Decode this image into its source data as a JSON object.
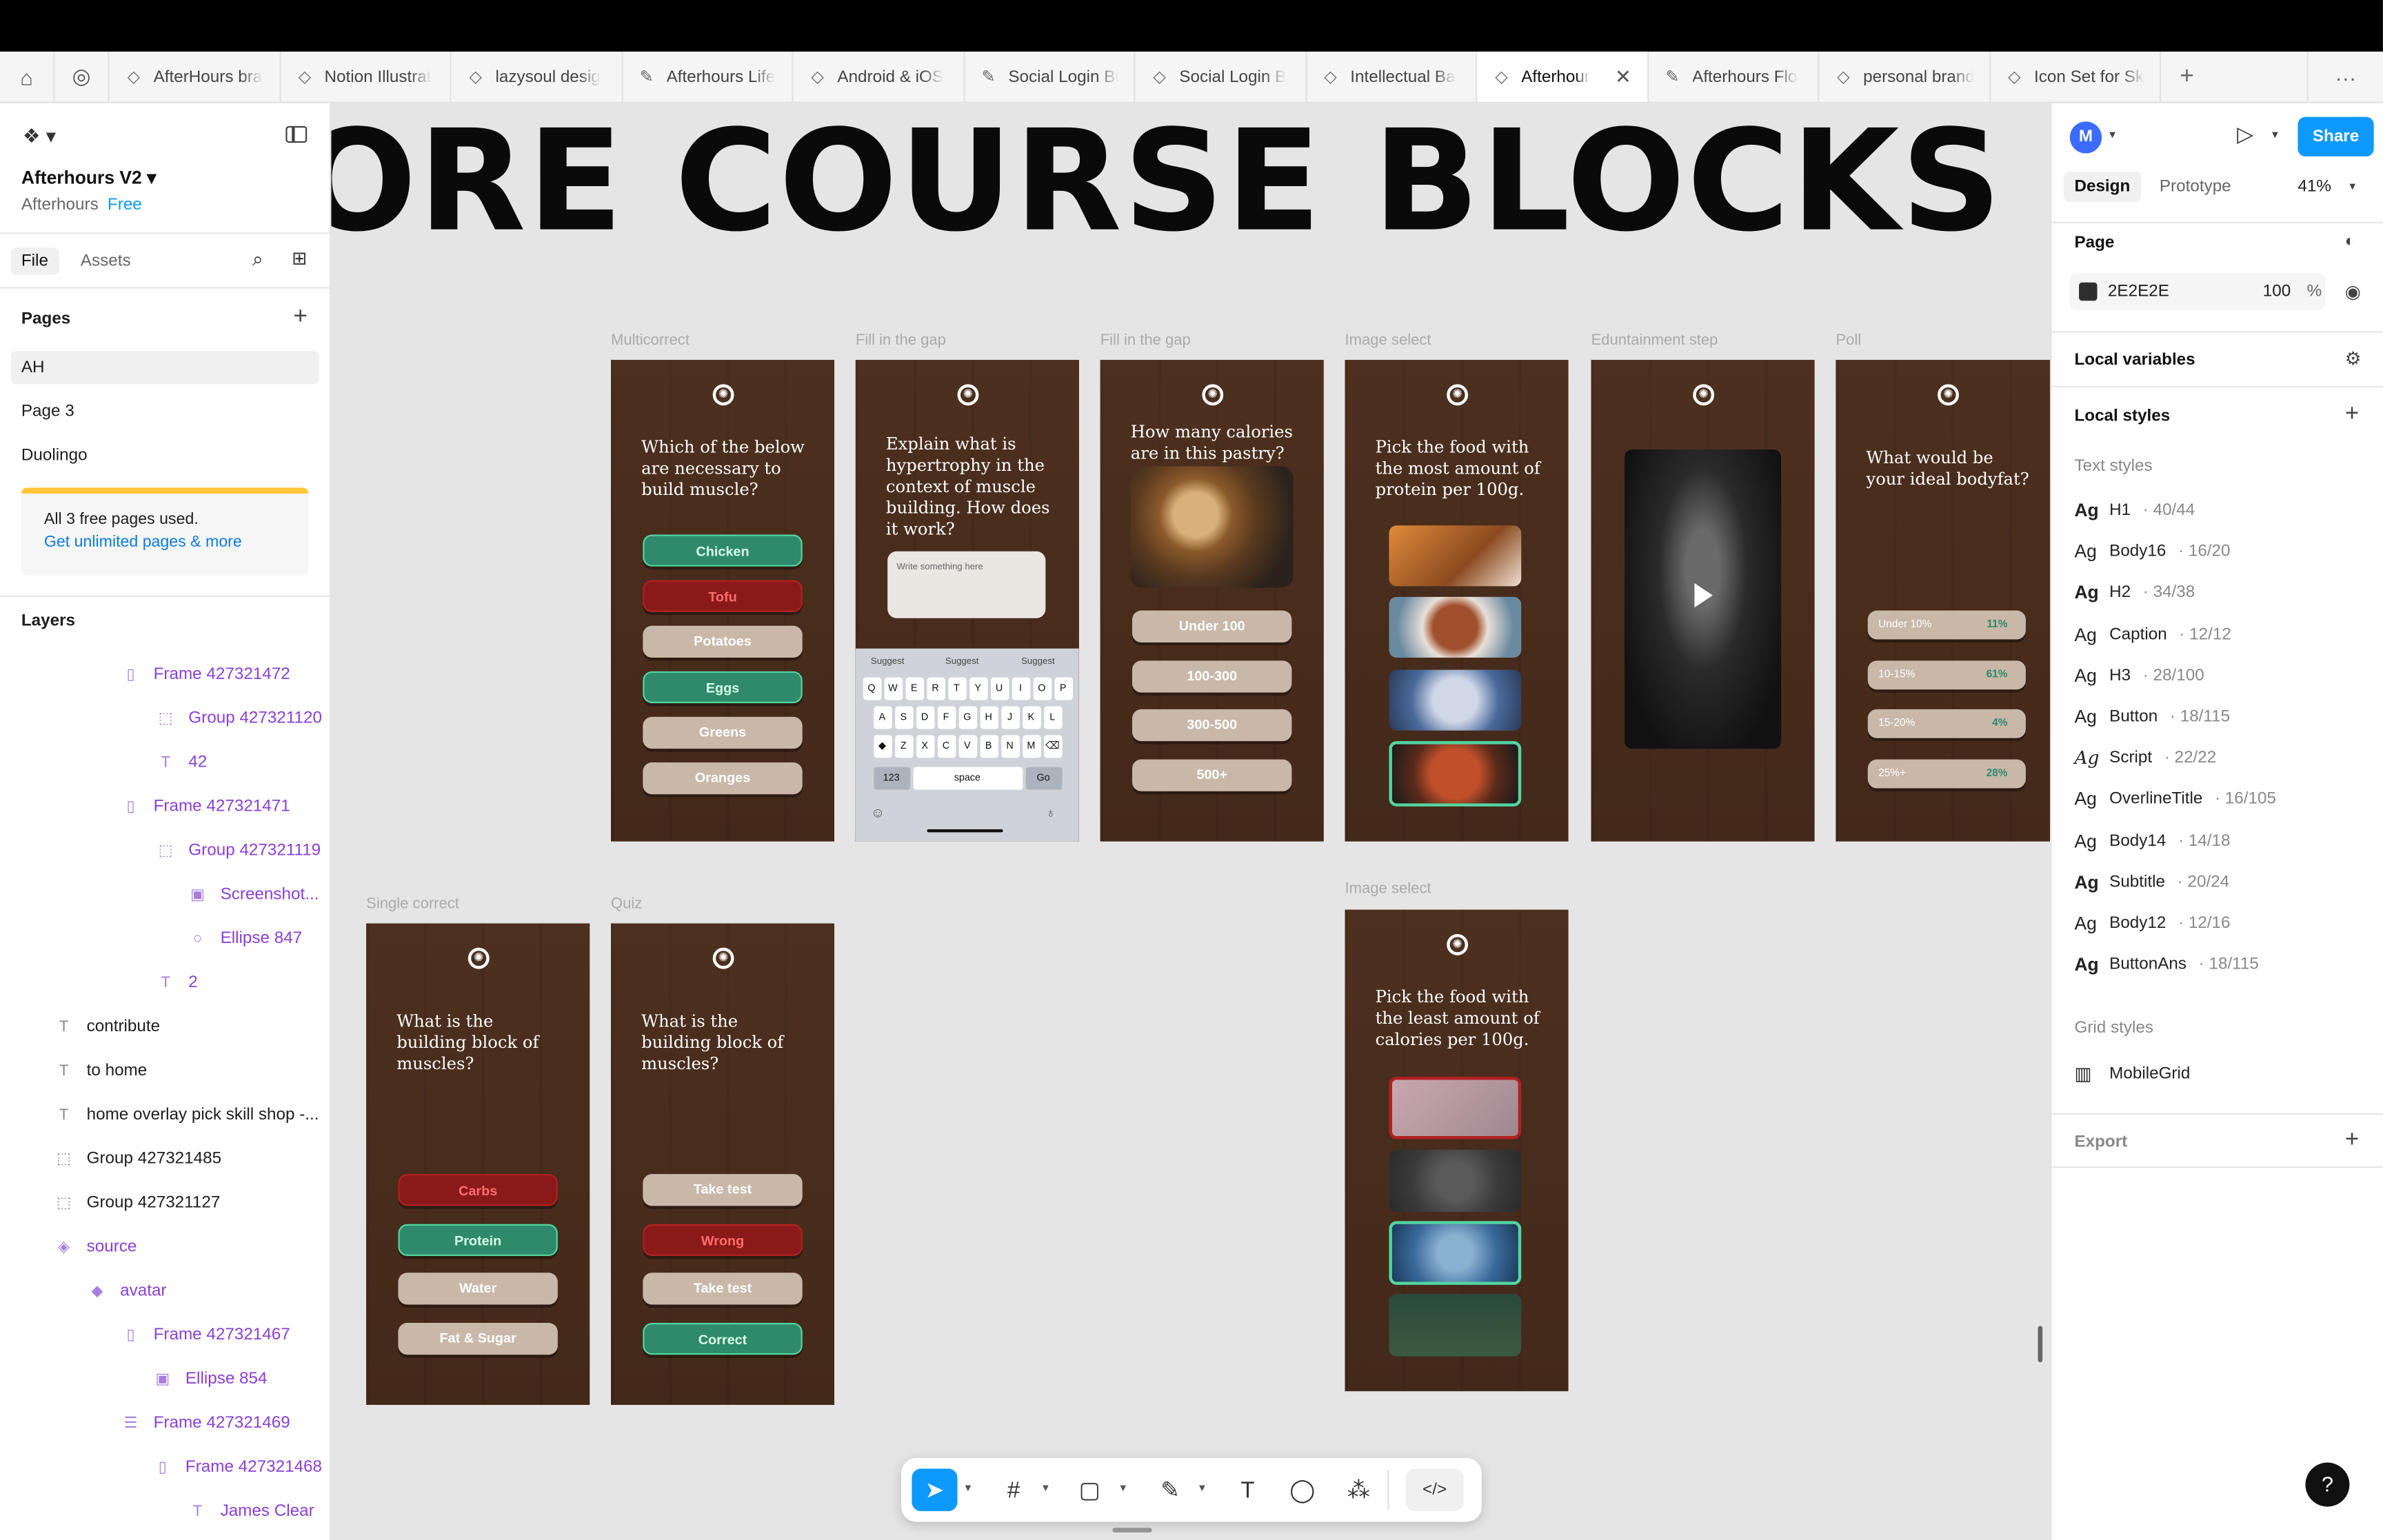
{
  "tabs": [
    {
      "label": "AfterHours bra",
      "icon": "figma-file-icon"
    },
    {
      "label": "Notion Illustrat",
      "icon": "figma-file-icon"
    },
    {
      "label": "lazysoul desig",
      "icon": "figma-file-icon"
    },
    {
      "label": "Afterhours Life",
      "icon": "figjam-icon"
    },
    {
      "label": "Android & iOS",
      "icon": "figma-file-icon"
    },
    {
      "label": "Social Login But",
      "icon": "figjam-icon"
    },
    {
      "label": "Social Login B",
      "icon": "figma-file-icon"
    },
    {
      "label": "Intellectual Ba",
      "icon": "figma-file-icon"
    },
    {
      "label": "Afterhour",
      "icon": "figma-file-icon",
      "active": true
    },
    {
      "label": "Afterhours Flo",
      "icon": "figjam-icon"
    },
    {
      "label": "personal brand",
      "icon": "figma-file-icon"
    },
    {
      "label": "Icon Set for Sk",
      "icon": "figma-file-icon"
    }
  ],
  "left_panel": {
    "file_title": "Afterhours V2",
    "team": "Afterhours",
    "plan": "Free",
    "tab_file": "File",
    "tab_assets": "Assets",
    "pages_title": "Pages",
    "pages": [
      "AH",
      "Page 3",
      "Duolingo"
    ],
    "notice_text": "All 3 free pages used.",
    "notice_link": "Get unlimited pages & more",
    "layers_title": "Layers",
    "layers": [
      {
        "name": "Frame 427321472",
        "icon": "▯",
        "indent": 80,
        "purple": true
      },
      {
        "name": "Group 427321120",
        "icon": "⬚",
        "indent": 103,
        "purple": true
      },
      {
        "name": "42",
        "icon": "T",
        "indent": 103,
        "purple": true
      },
      {
        "name": "Frame 427321471",
        "icon": "▯",
        "indent": 80,
        "purple": true
      },
      {
        "name": "Group 427321119",
        "icon": "⬚",
        "indent": 103,
        "purple": true
      },
      {
        "name": "Screenshot...",
        "icon": "▣",
        "indent": 124,
        "purple": true
      },
      {
        "name": "Ellipse 847",
        "icon": "○",
        "indent": 124,
        "purple": true
      },
      {
        "name": "2",
        "icon": "T",
        "indent": 103,
        "purple": true
      },
      {
        "name": "contribute",
        "icon": "T",
        "indent": 36,
        "purple": false
      },
      {
        "name": "to home",
        "icon": "T",
        "indent": 36,
        "purple": false
      },
      {
        "name": "home overlay pick skill shop -...",
        "icon": "T",
        "indent": 36,
        "purple": false
      },
      {
        "name": "Group 427321485",
        "icon": "⬚",
        "indent": 36,
        "purple": false
      },
      {
        "name": "Group 427321127",
        "icon": "⬚",
        "indent": 36,
        "purple": false
      },
      {
        "name": "source",
        "icon": "◈",
        "indent": 36,
        "purple": true
      },
      {
        "name": "avatar",
        "icon": "◆",
        "indent": 58,
        "purple": true
      },
      {
        "name": "Frame 427321467",
        "icon": "▯",
        "indent": 80,
        "purple": true
      },
      {
        "name": "Ellipse 854",
        "icon": "▣",
        "indent": 101,
        "purple": true
      },
      {
        "name": "Frame 427321469",
        "icon": "☰",
        "indent": 80,
        "purple": true
      },
      {
        "name": "Frame 427321468",
        "icon": "▯",
        "indent": 101,
        "purple": true
      },
      {
        "name": "James Clear",
        "icon": "T",
        "indent": 124,
        "purple": true
      }
    ]
  },
  "canvas": {
    "title": "ORE COURSE BLOCKS",
    "frames": {
      "multicorrect": {
        "label": "Multicorrect",
        "question": "Which of the below are necessary to build muscle?",
        "options": [
          {
            "text": "Chicken",
            "state": "g"
          },
          {
            "text": "Tofu",
            "state": "r"
          },
          {
            "text": "Potatoes",
            "state": "n"
          },
          {
            "text": "Eggs",
            "state": "g"
          },
          {
            "text": "Greens",
            "state": "n"
          },
          {
            "text": "Oranges",
            "state": "n"
          }
        ]
      },
      "fill_gap_1": {
        "label": "Fill in the gap",
        "question": "Explain what is hypertrophy in the context of muscle building. How does it work?",
        "placeholder": "Write something here",
        "suggestions": [
          "Suggest",
          "Suggest",
          "Suggest"
        ],
        "keys_row1": [
          "Q",
          "W",
          "E",
          "R",
          "T",
          "Y",
          "U",
          "I",
          "O",
          "P"
        ],
        "keys_row2": [
          "A",
          "S",
          "D",
          "F",
          "G",
          "H",
          "J",
          "K",
          "L"
        ],
        "keys_row3": [
          "◆",
          "Z",
          "X",
          "C",
          "V",
          "B",
          "N",
          "M",
          "⌫"
        ],
        "key_123": "123",
        "key_space": "space",
        "key_go": "Go"
      },
      "fill_gap_2": {
        "label": "Fill in the gap",
        "question": "How many calories are in this pastry?",
        "options": [
          "Under 100",
          "100-300",
          "300-500",
          "500+"
        ]
      },
      "image_select_1": {
        "label": "Image select",
        "question": "Pick the food with the most amount of protein per 100g."
      },
      "edutainment": {
        "label": "Eduntainment step"
      },
      "poll": {
        "label": "Poll",
        "question": "What would be your ideal bodyfat?",
        "options": [
          {
            "text": "Under 10%",
            "value": "11%"
          },
          {
            "text": "10-15%",
            "value": "61%"
          },
          {
            "text": "15-20%",
            "value": "4%"
          },
          {
            "text": "25%+",
            "value": "28%"
          }
        ]
      },
      "single_correct": {
        "label": "Single correct",
        "question": "What is the building block of muscles?",
        "options": [
          {
            "text": "Carbs",
            "state": "r"
          },
          {
            "text": "Protein",
            "state": "g"
          },
          {
            "text": "Water",
            "state": "n"
          },
          {
            "text": "Fat & Sugar",
            "state": "n"
          }
        ]
      },
      "quiz": {
        "label": "Quiz",
        "question": "What is the building block of muscles?",
        "options": [
          {
            "text": "Take test",
            "state": "n"
          },
          {
            "text": "Wrong",
            "state": "r"
          },
          {
            "text": "Take test",
            "state": "n"
          },
          {
            "text": "Correct",
            "state": "g"
          }
        ]
      },
      "image_select_2": {
        "label": "Image select",
        "question": "Pick the food with the least amount of calories per 100g."
      }
    }
  },
  "right_panel": {
    "avatar_initial": "M",
    "share_label": "Share",
    "tab_design": "Design",
    "tab_prototype": "Prototype",
    "zoom": "41%",
    "page_title": "Page",
    "page_color": "2E2E2E",
    "page_opacity": "100",
    "percent": "%",
    "local_variables": "Local variables",
    "local_styles": "Local styles",
    "text_styles_title": "Text styles",
    "text_styles": [
      {
        "name": "H1",
        "size": "· 40/44",
        "bold": true
      },
      {
        "name": "Body16",
        "size": "· 16/20",
        "bold": false
      },
      {
        "name": "H2",
        "size": "· 34/38",
        "bold": true
      },
      {
        "name": "Caption",
        "size": "· 12/12",
        "bold": false
      },
      {
        "name": "H3",
        "size": "· 28/100",
        "bold": false
      },
      {
        "name": "Button",
        "size": "· 18/115",
        "bold": false
      },
      {
        "name": "Script",
        "size": "· 22/22",
        "bold": false
      },
      {
        "name": "OverlineTitle",
        "size": "· 16/105",
        "bold": false
      },
      {
        "name": "Body14",
        "size": "· 14/18",
        "bold": false
      },
      {
        "name": "Subtitle",
        "size": "· 20/24",
        "bold": true
      },
      {
        "name": "Body12",
        "size": "· 12/16",
        "bold": false
      },
      {
        "name": "ButtonAns",
        "size": "· 18/115",
        "bold": true
      }
    ],
    "grid_styles_title": "Grid styles",
    "grid_style": "MobileGrid",
    "export_title": "Export"
  },
  "colors": {
    "accent": "#0d99ff",
    "phone_bg": "#4a2e1c",
    "correct_green": "#2e8a6a",
    "wrong_red": "#8a1a1a",
    "neutral_option": "#c9b8a8"
  }
}
